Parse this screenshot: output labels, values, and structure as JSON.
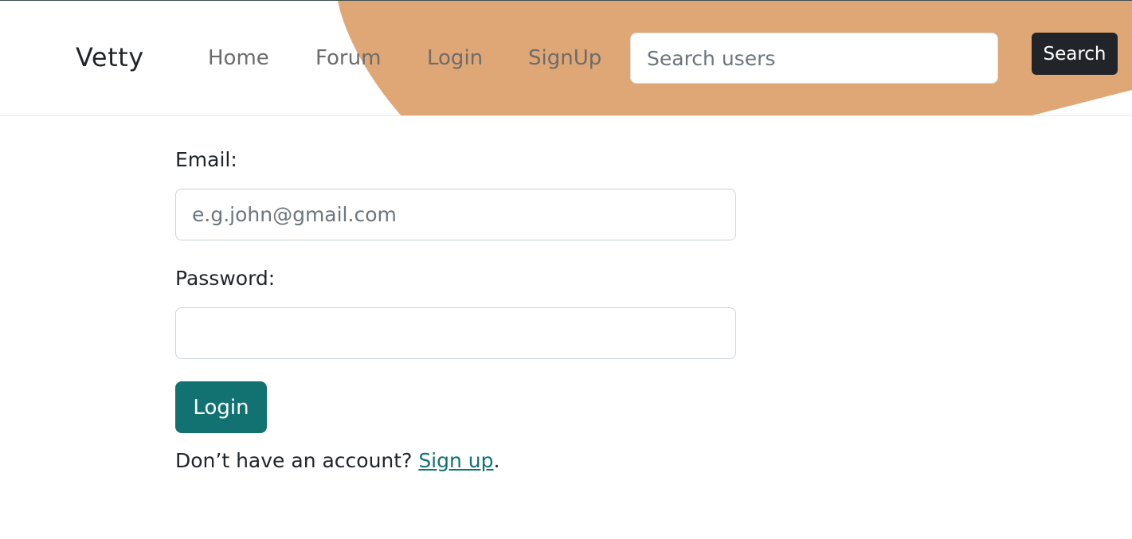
{
  "colors": {
    "accent": "#127271",
    "decoration": "#e0a776",
    "search_button_bg": "#212529",
    "text": "#212529",
    "nav_link": "#6c6c6c"
  },
  "navbar": {
    "brand": "Vetty",
    "links": [
      {
        "label": "Home"
      },
      {
        "label": "Forum"
      },
      {
        "label": "Login"
      },
      {
        "label": "SignUp"
      }
    ],
    "search": {
      "placeholder": "Search users",
      "value": "",
      "button_label": "Search"
    }
  },
  "login_form": {
    "email_label": "Email:",
    "email_placeholder": "e.g.john@gmail.com",
    "email_value": "",
    "password_label": "Password:",
    "password_value": "",
    "submit_label": "Login",
    "signup_prompt": "Don’t have an account? ",
    "signup_link": "Sign up",
    "signup_suffix": "."
  }
}
